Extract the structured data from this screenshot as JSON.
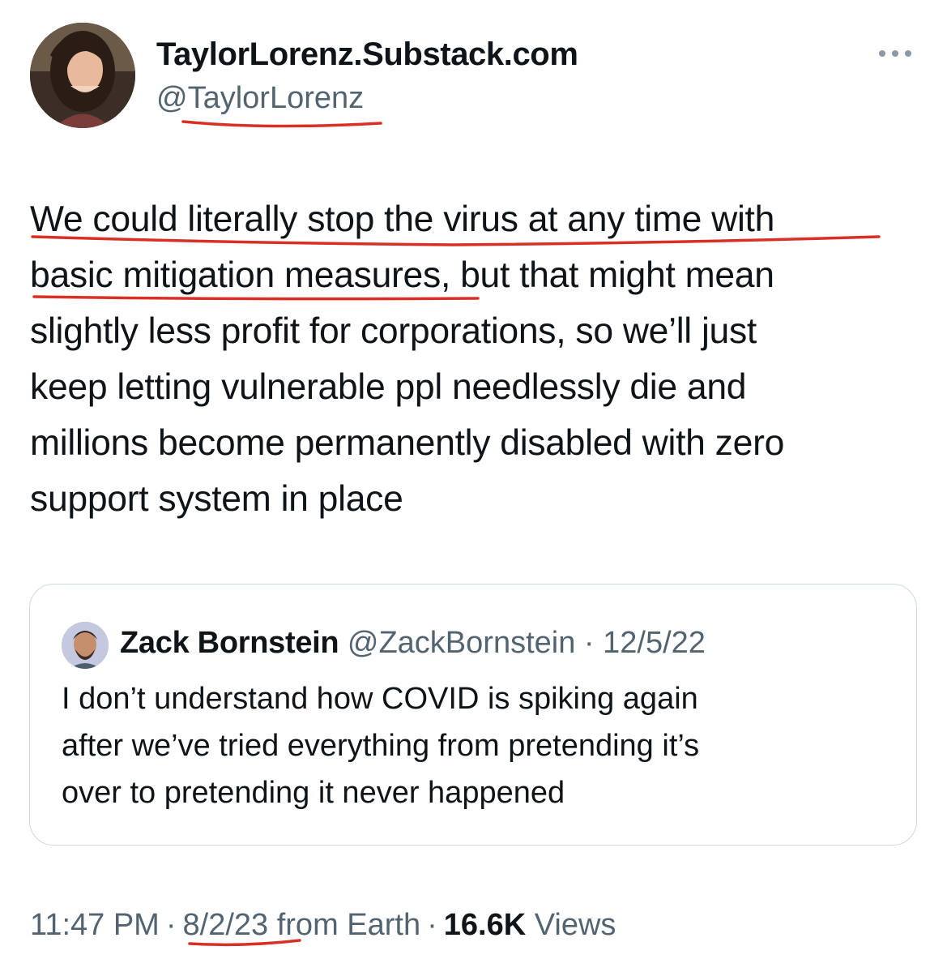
{
  "author": {
    "display_name": "TaylorLorenz.Substack.com",
    "handle": "@TaylorLorenz",
    "more_icon": "ellipsis-icon"
  },
  "tweet": {
    "text": "We could literally stop the virus at any time with\nbasic mitigation measures, but that might mean\nslightly less profit for corporations, so we’ll just\nkeep letting vulnerable ppl needlessly die and\nmillions become permanently disabled with zero\nsupport system in place"
  },
  "quoted_tweet": {
    "name": "Zack Bornstein",
    "handle": "@ZackBornstein",
    "separator": "·",
    "date": "12/5/22",
    "text": "I don’t understand how COVID is spiking again\nafter we’ve tried everything from pretending it’s\nover to pretending it never happened"
  },
  "meta": {
    "time": "11:47 PM",
    "sep1": "·",
    "date": "8/2/23",
    "source": "from Earth",
    "sep2": "·",
    "views_count": "16.6K",
    "views_label": "Views"
  },
  "colors": {
    "text": "#0f1419",
    "secondary": "#536471",
    "border": "#cfd9de",
    "annotation_red": "#d93025"
  }
}
